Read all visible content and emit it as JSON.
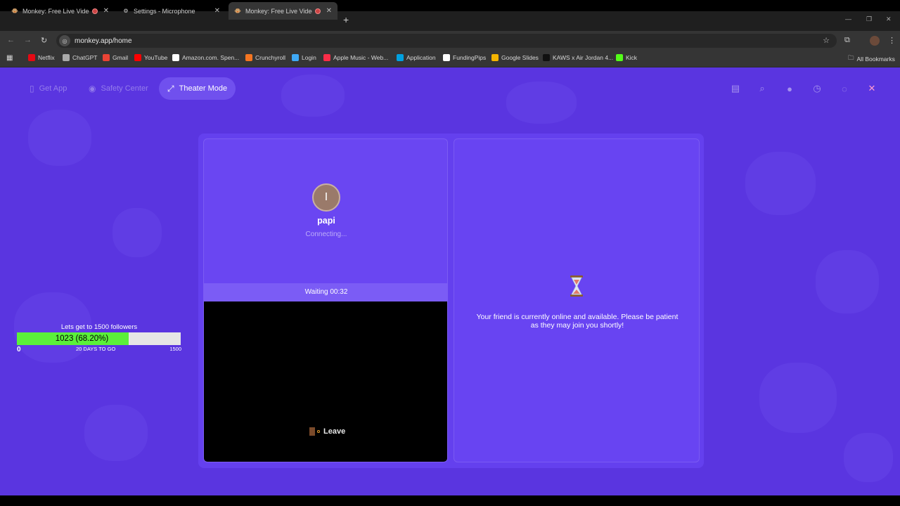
{
  "browser": {
    "tabs": [
      {
        "title": "Monkey: Free Live Video Ch",
        "active": false,
        "recording": true
      },
      {
        "title": "Settings - Microphone",
        "active": false,
        "recording": false
      },
      {
        "title": "Monkey: Free Live Video Ch",
        "active": true,
        "recording": true
      }
    ],
    "url": "monkey.app/home",
    "bookmarks": [
      {
        "label": "Netflix",
        "color": "#e50914"
      },
      {
        "label": "ChatGPT",
        "color": "#aaaaaa"
      },
      {
        "label": "Gmail",
        "color": "#ea4335"
      },
      {
        "label": "YouTube",
        "color": "#ff0000"
      },
      {
        "label": "Amazon.com. Spen...",
        "color": "#ffffff"
      },
      {
        "label": "Crunchyroll",
        "color": "#f47521"
      },
      {
        "label": "Login",
        "color": "#3fa9f5"
      },
      {
        "label": "Apple Music - Web...",
        "color": "#fa2d48"
      },
      {
        "label": "Application",
        "color": "#00a1e0"
      },
      {
        "label": "FundingPips",
        "color": "#ffffff"
      },
      {
        "label": "Google Slides",
        "color": "#f4b400"
      },
      {
        "label": "KAWS x Air Jordan 4...",
        "color": "#111111"
      },
      {
        "label": "Kick",
        "color": "#53fc18"
      }
    ],
    "all_bookmarks": "All Bookmarks"
  },
  "app_nav": {
    "get_app": "Get App",
    "safety_center": "Safety Center",
    "theater_mode": "Theater Mode"
  },
  "goal": {
    "title": "Lets get to 1500 followers",
    "value_text": "1023 (68.20%)",
    "progress": 0.682,
    "min_label": "0",
    "days_label": "20 DAYS TO GO",
    "max_label": "1500"
  },
  "call": {
    "avatar_letter": "I",
    "username": "papi",
    "status": "Connecting...",
    "waiting": "Waiting 00:32",
    "leave": "Leave"
  },
  "friend_panel": {
    "message": "Your friend is currently online and available. Please be patient as they may join you shortly!"
  },
  "colors": {
    "page_bg": "#5a35e0",
    "card": "#6a46f2",
    "progress_fill": "#5bf03a"
  }
}
